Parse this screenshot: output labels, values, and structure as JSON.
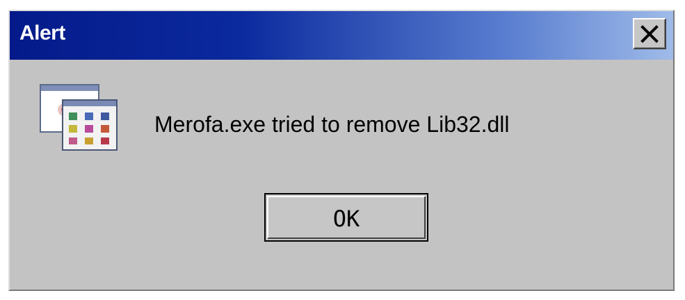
{
  "window": {
    "title": "Alert",
    "close_icon": "close-icon"
  },
  "content": {
    "app_icon": "application-windows-icon",
    "message": "Merofa.exe tried to remove Lib32.dll"
  },
  "buttons": {
    "ok_label": "OK"
  },
  "colors": {
    "titlebar_start": "#041a8a",
    "titlebar_end": "#9fbbe8",
    "dialog_bg": "#c3c3c3"
  }
}
